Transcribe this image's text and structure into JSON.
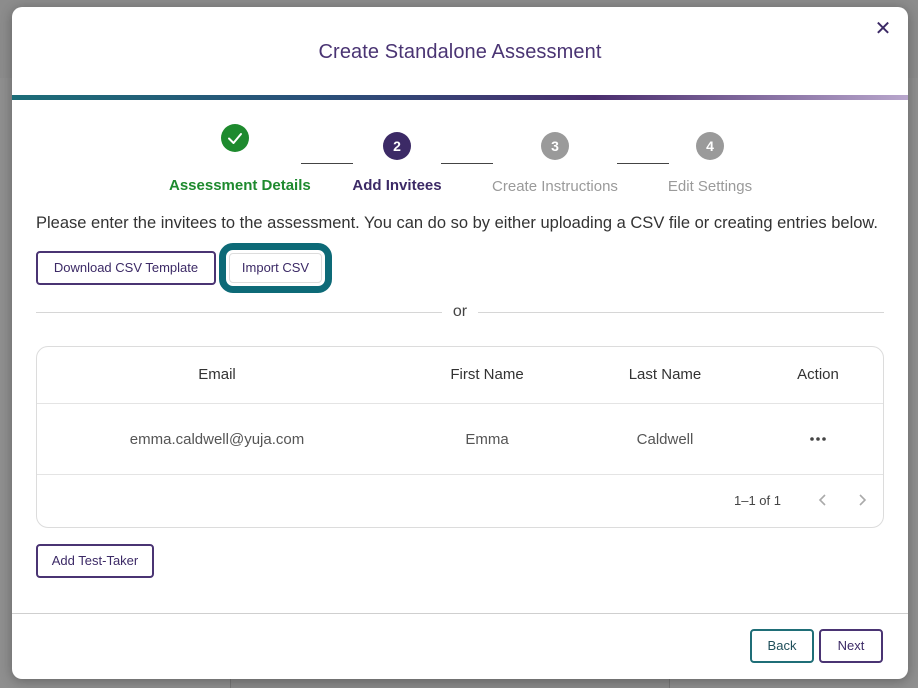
{
  "modal": {
    "title": "Create Standalone Assessment",
    "close_icon": "close-icon"
  },
  "stepper": {
    "steps": [
      {
        "number": "1",
        "label": "Assessment Details",
        "state": "completed",
        "color": "#1e8a2e"
      },
      {
        "number": "2",
        "label": "Add Invitees",
        "state": "active",
        "color": "#3c2a66"
      },
      {
        "number": "3",
        "label": "Create Instructions",
        "state": "upcoming",
        "color": "#9a9a9a"
      },
      {
        "number": "4",
        "label": "Edit Settings",
        "state": "upcoming",
        "color": "#9a9a9a"
      }
    ]
  },
  "intro_text": "Please enter the invitees to the assessment. You can do so by either uploading a CSV file or creating entries below.",
  "buttons": {
    "download_csv": "Download CSV Template",
    "import_csv": "Import CSV",
    "add_test_taker": "Add Test-Taker",
    "back": "Back",
    "next": "Next"
  },
  "divider_text": "or",
  "table": {
    "headers": [
      "Email",
      "First Name",
      "Last Name",
      "Action"
    ],
    "rows": [
      {
        "email": "emma.caldwell@yuja.com",
        "first_name": "Emma",
        "last_name": "Caldwell",
        "action_icon": "more-horizontal-icon"
      }
    ],
    "pagination": "1–1 of 1"
  },
  "colors": {
    "brand_purple": "#4a3473",
    "highlight_teal": "#0d6a77",
    "success_green": "#1e8a2e"
  }
}
